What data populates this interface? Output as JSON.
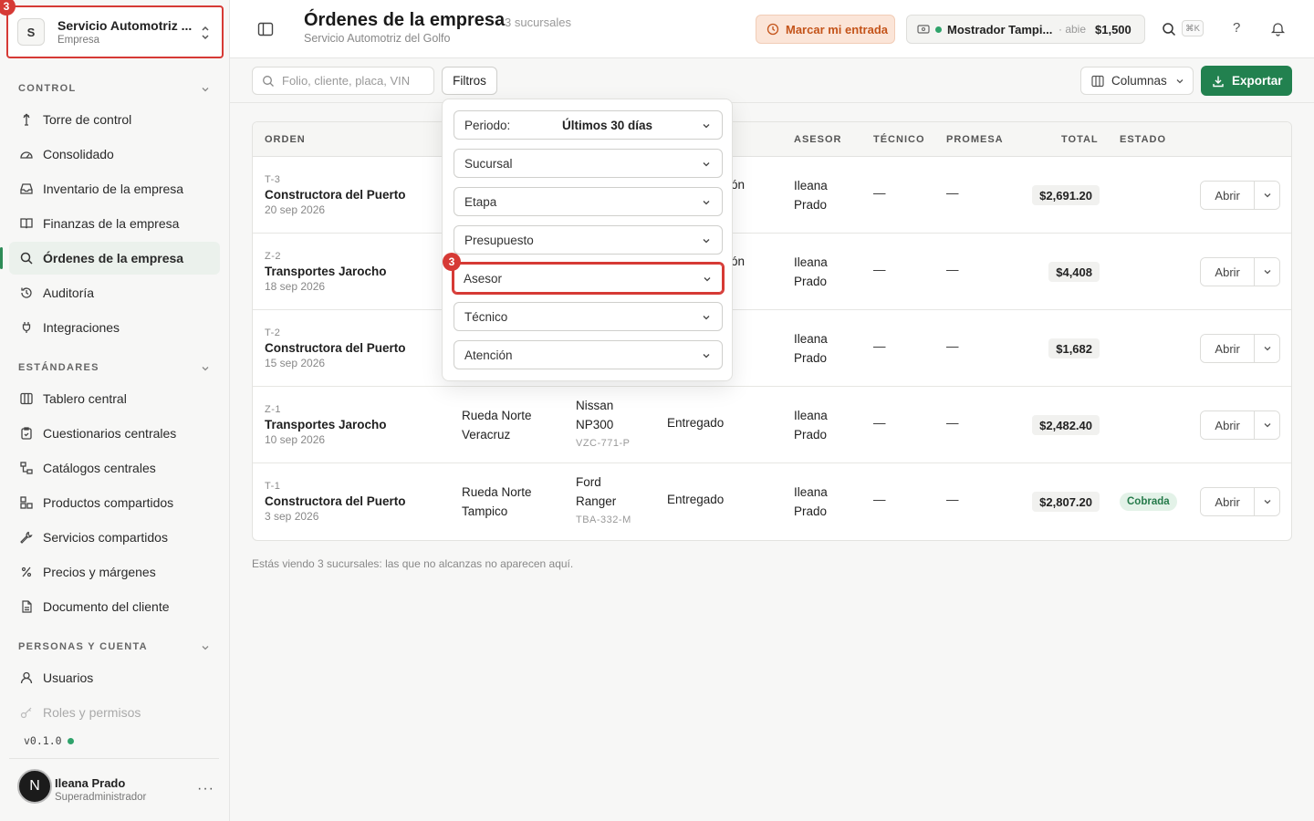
{
  "company": {
    "initial": "S",
    "name": "Servicio Automotriz ...",
    "type": "Empresa",
    "badge": "3"
  },
  "sidebar": {
    "sections": [
      {
        "title": "CONTROL",
        "items": [
          {
            "label": "Torre de control",
            "icon": "tower-icon"
          },
          {
            "label": "Consolidado",
            "icon": "dashboard-gauge-icon"
          },
          {
            "label": "Inventario de la empresa",
            "icon": "inbox-icon"
          },
          {
            "label": "Finanzas de la empresa",
            "icon": "book-icon"
          },
          {
            "label": "Órdenes de la empresa",
            "icon": "search-icon",
            "active": true
          },
          {
            "label": "Auditoría",
            "icon": "history-icon"
          },
          {
            "label": "Integraciones",
            "icon": "plug-icon"
          }
        ]
      },
      {
        "title": "ESTÁNDARES",
        "items": [
          {
            "label": "Tablero central",
            "icon": "columns-icon"
          },
          {
            "label": "Cuestionarios centrales",
            "icon": "clipboard-icon"
          },
          {
            "label": "Catálogos centrales",
            "icon": "hierarchy-icon"
          },
          {
            "label": "Productos compartidos",
            "icon": "boxes-icon"
          },
          {
            "label": "Servicios compartidos",
            "icon": "wrench-icon"
          },
          {
            "label": "Precios y márgenes",
            "icon": "percent-icon"
          },
          {
            "label": "Documento del cliente",
            "icon": "document-icon"
          }
        ]
      },
      {
        "title": "PERSONAS Y CUENTA",
        "items": [
          {
            "label": "Usuarios",
            "icon": "user-icon"
          },
          {
            "label": "Roles y permisos",
            "icon": "key-icon"
          }
        ]
      }
    ],
    "version": "v0.1.0"
  },
  "user": {
    "initial": "N",
    "name": "Ileana Prado",
    "role": "Superadministrador",
    "more": "···"
  },
  "header": {
    "title": "Órdenes de la empresa",
    "subtitle": "Servicio Automotriz del Golfo",
    "count": "3 sucursales",
    "entrada_label": "Marcar mi entrada",
    "mostrador_name": "Mostrador Tampi...",
    "mostrador_state": "· abie",
    "mostrador_amount": "$1,500",
    "shortcut": "⌘K",
    "help": "?"
  },
  "toolbar": {
    "search_placeholder": "Folio, cliente, placa, VIN",
    "filters_label": "Filtros",
    "columns_label": "Columnas",
    "export_label": "Exportar"
  },
  "filters": {
    "badge": "3",
    "period_label": "Periodo:",
    "period_value": "Últimos 30 días",
    "fields": [
      "Sucursal",
      "Etapa",
      "Presupuesto",
      "Asesor",
      "Técnico",
      "Atención"
    ]
  },
  "table": {
    "headers": [
      "ORDEN",
      "ASESOR",
      "TÉCNICO",
      "PROMESA",
      "TOTAL",
      "ESTADO"
    ],
    "rows": [
      {
        "folio": "T-3",
        "client": "Constructora del Puerto",
        "date": "20 sep 2026",
        "stage": "ón",
        "advisor": [
          "Ileana",
          "Prado"
        ],
        "tech": "—",
        "promise": "—",
        "total": "$2,691.20",
        "status": "",
        "open": "Abrir"
      },
      {
        "folio": "Z-2",
        "client": "Transportes Jarocho",
        "date": "18 sep 2026",
        "stage": "ón",
        "advisor": [
          "Ileana",
          "Prado"
        ],
        "tech": "—",
        "promise": "—",
        "total": "$4,408",
        "status": "",
        "open": "Abrir"
      },
      {
        "folio": "T-2",
        "client": "Constructora del Puerto",
        "date": "15 sep 2026",
        "stage": "",
        "advisor": [
          "Ileana",
          "Prado"
        ],
        "tech": "—",
        "promise": "—",
        "total": "$1,682",
        "status": "",
        "open": "Abrir"
      },
      {
        "folio": "Z-1",
        "client": "Transportes Jarocho",
        "date": "10 sep 2026",
        "branch": [
          "Rueda Norte",
          "Veracruz"
        ],
        "vehicle": [
          "Nissan",
          "NP300"
        ],
        "plate": "VZC-771-P",
        "stage": "Entregado",
        "advisor": [
          "Ileana",
          "Prado"
        ],
        "tech": "—",
        "promise": "—",
        "total": "$2,482.40",
        "status": "",
        "open": "Abrir"
      },
      {
        "folio": "T-1",
        "client": "Constructora del Puerto",
        "date": "3 sep 2026",
        "branch": [
          "Rueda Norte",
          "Tampico"
        ],
        "vehicle": [
          "Ford",
          "Ranger"
        ],
        "plate": "TBA-332-M",
        "stage": "Entregado",
        "advisor": [
          "Ileana",
          "Prado"
        ],
        "tech": "—",
        "promise": "—",
        "total": "$2,807.20",
        "status": "Cobrada",
        "open": "Abrir"
      }
    ]
  },
  "footnote": "Estás viendo 3 sucursales: las que no alcanzas no aparecen aquí.",
  "colors": {
    "accent": "#22814f",
    "highlight": "#d63a35",
    "warning_bg": "#fbe5d8"
  }
}
